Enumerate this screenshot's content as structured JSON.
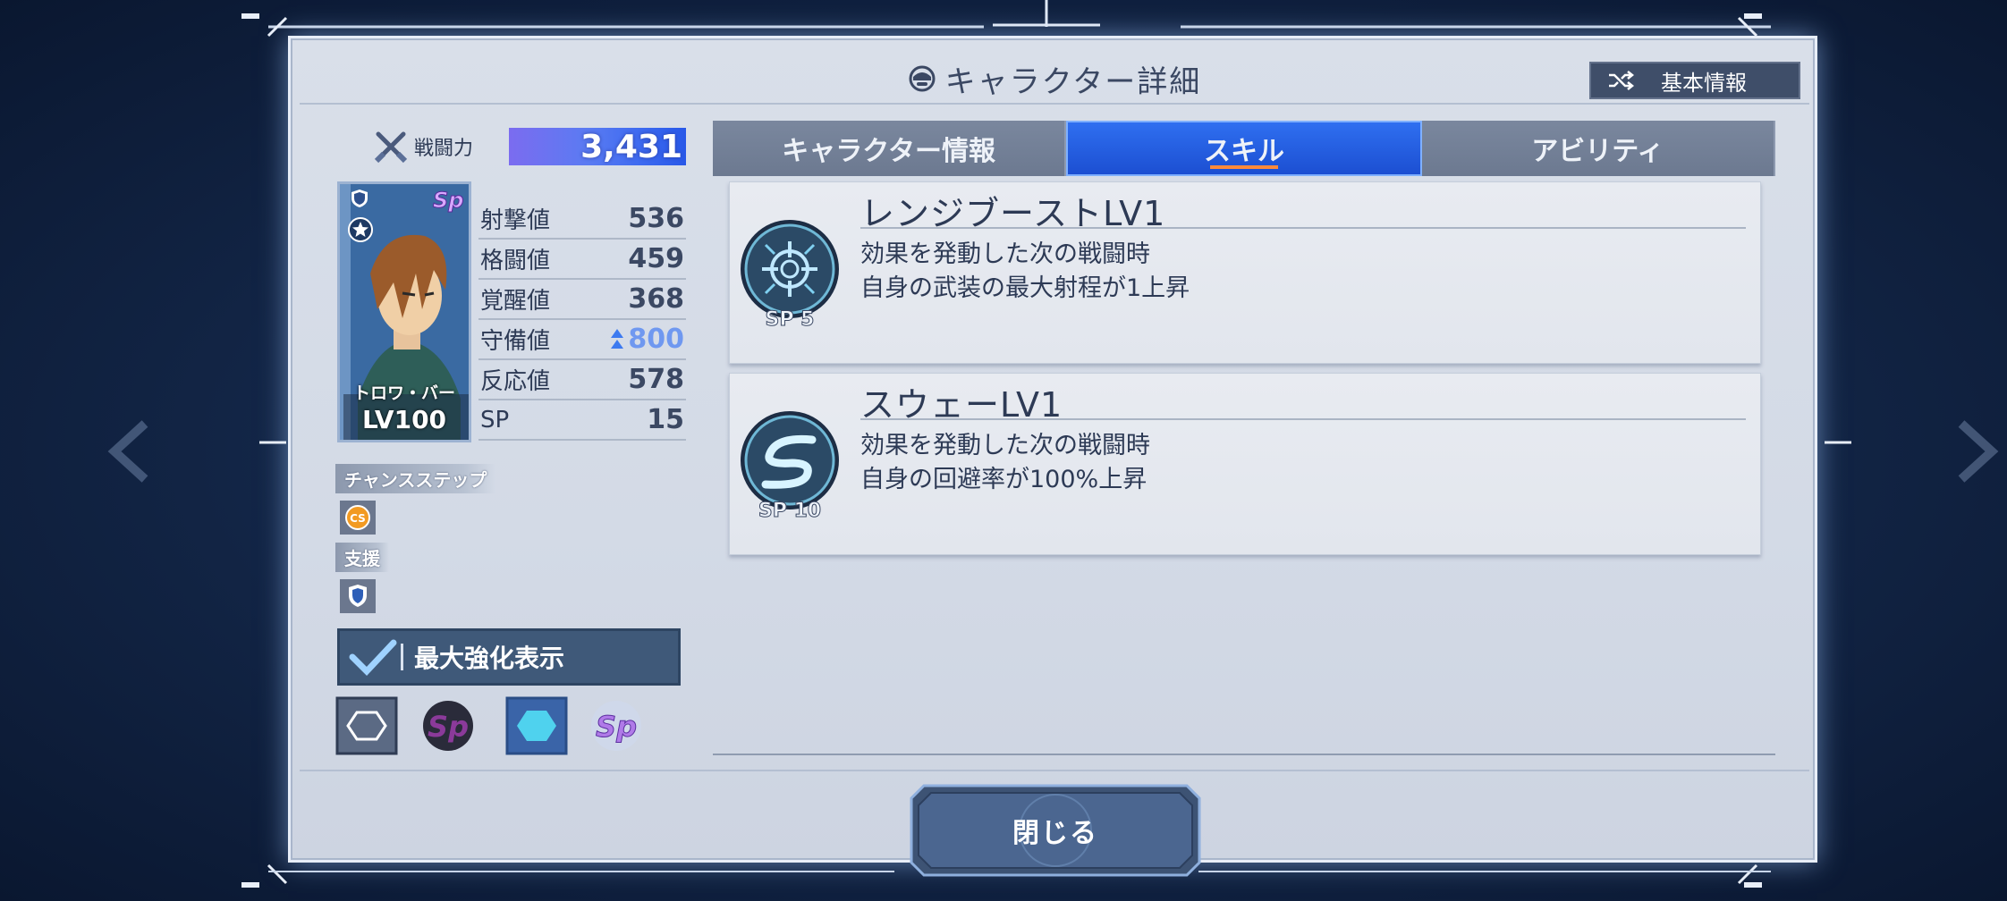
{
  "header": {
    "title": "キャラクター詳細",
    "basic_info_label": "基本情報"
  },
  "power": {
    "label": "戦闘力",
    "value": "3,431"
  },
  "character": {
    "name": "トロワ・バー",
    "level": "LV100"
  },
  "stats": [
    {
      "label": "射撃値",
      "value": "536",
      "boosted": false
    },
    {
      "label": "格闘値",
      "value": "459",
      "boosted": false
    },
    {
      "label": "覚醒値",
      "value": "368",
      "boosted": false
    },
    {
      "label": "守備値",
      "value": "800",
      "boosted": true
    },
    {
      "label": "反応値",
      "value": "578",
      "boosted": false
    },
    {
      "label": "SP",
      "value": "15",
      "boosted": false
    }
  ],
  "tags": {
    "chance_step": "チャンスステップ",
    "cs_badge": "CS",
    "support": "支援"
  },
  "max_enhance_label": "最大強化表示",
  "tabs": [
    {
      "label": "キャラクター情報",
      "active": false
    },
    {
      "label": "スキル",
      "active": true
    },
    {
      "label": "アビリティ",
      "active": false
    }
  ],
  "skills": [
    {
      "name": "レンジブーストLV1",
      "desc1": "効果を発動した次の戦闘時",
      "desc2": "自身の武装の最大射程が1上昇",
      "sp": "SP 5",
      "icon": "crosshair-icon"
    },
    {
      "name": "スウェーLV1",
      "desc1": "効果を発動した次の戦闘時",
      "desc2": "自身の回避率が100%上昇",
      "sp": "SP 10",
      "icon": "swerve-icon"
    }
  ],
  "close_label": "閉じる",
  "colors": {
    "active_tab": "#1c4fd2",
    "tab": "#6c7990",
    "panel": "#d3dae6",
    "accent_orange": "#ff8a3a",
    "boost_blue": "#6f98f0"
  }
}
